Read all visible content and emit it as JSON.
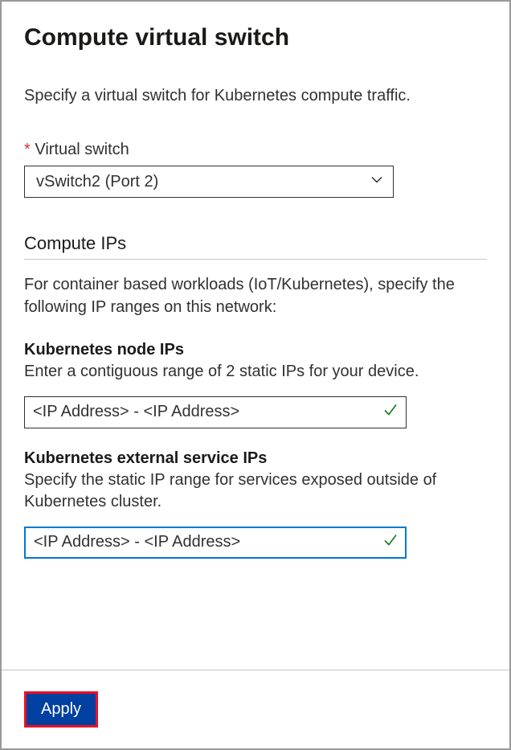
{
  "header": {
    "title": "Compute virtual switch"
  },
  "intro": "Specify a virtual switch for Kubernetes compute traffic.",
  "virtualSwitch": {
    "label": "Virtual switch",
    "required": "* ",
    "value": "vSwitch2 (Port 2)"
  },
  "computeIPs": {
    "heading": "Compute IPs",
    "description": "For container based workloads (IoT/Kubernetes), specify the following IP ranges on this network:"
  },
  "nodeIPs": {
    "label": "Kubernetes node IPs",
    "description": "Enter a contiguous range of 2 static IPs for your device.",
    "placeholder": "<IP Address> - <IP Address>",
    "value": "<IP Address> - <IP Address>"
  },
  "serviceIPs": {
    "label": "Kubernetes external service IPs",
    "description": "Specify the static IP range for services exposed outside of Kubernetes cluster.",
    "placeholder": "<IP Address> - <IP Address>",
    "value": "<IP Address> - <IP Address>"
  },
  "buttons": {
    "apply": "Apply"
  }
}
